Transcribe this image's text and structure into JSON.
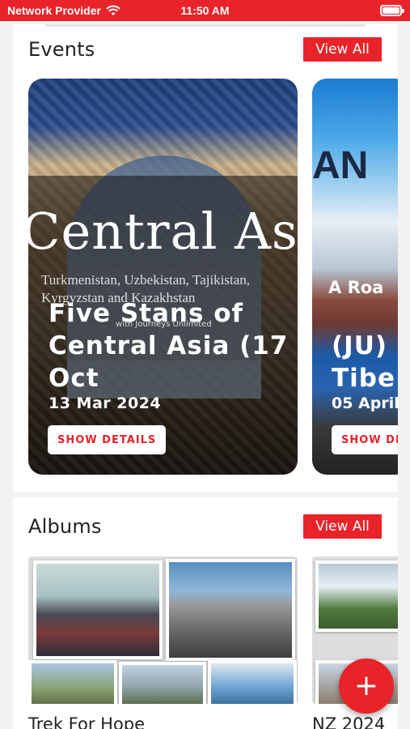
{
  "status_bar": {
    "carrier": "Network Provider",
    "time": "11:50 AM",
    "battery_level": 1.0
  },
  "events": {
    "title": "Events",
    "view_all_label": "View All",
    "items": [
      {
        "poster_title": "Central Asia",
        "poster_subtitle": "Turkmenistan, Uzbekistan, Tajikistan, Kyrgyzstan and Kazakhstan",
        "poster_credit": "with Journeys Unlimited",
        "name": "Five Stans of Central Asia (17 Oct",
        "date": "13 Mar 2024",
        "button_label": "SHOW DETAILS"
      },
      {
        "poster_text": "AN",
        "poster_subtitle": "A Roa",
        "name": "(JU)\nTibe",
        "date": "05 April",
        "button_label": "SHOW DETAILS"
      }
    ]
  },
  "albums": {
    "title": "Albums",
    "view_all_label": "View All",
    "items": [
      {
        "name": "Trek For Hope"
      },
      {
        "name": "NZ 2024"
      }
    ]
  },
  "fab": {
    "icon": "plus-icon",
    "label": "+"
  },
  "colors": {
    "accent": "#e8232a"
  }
}
